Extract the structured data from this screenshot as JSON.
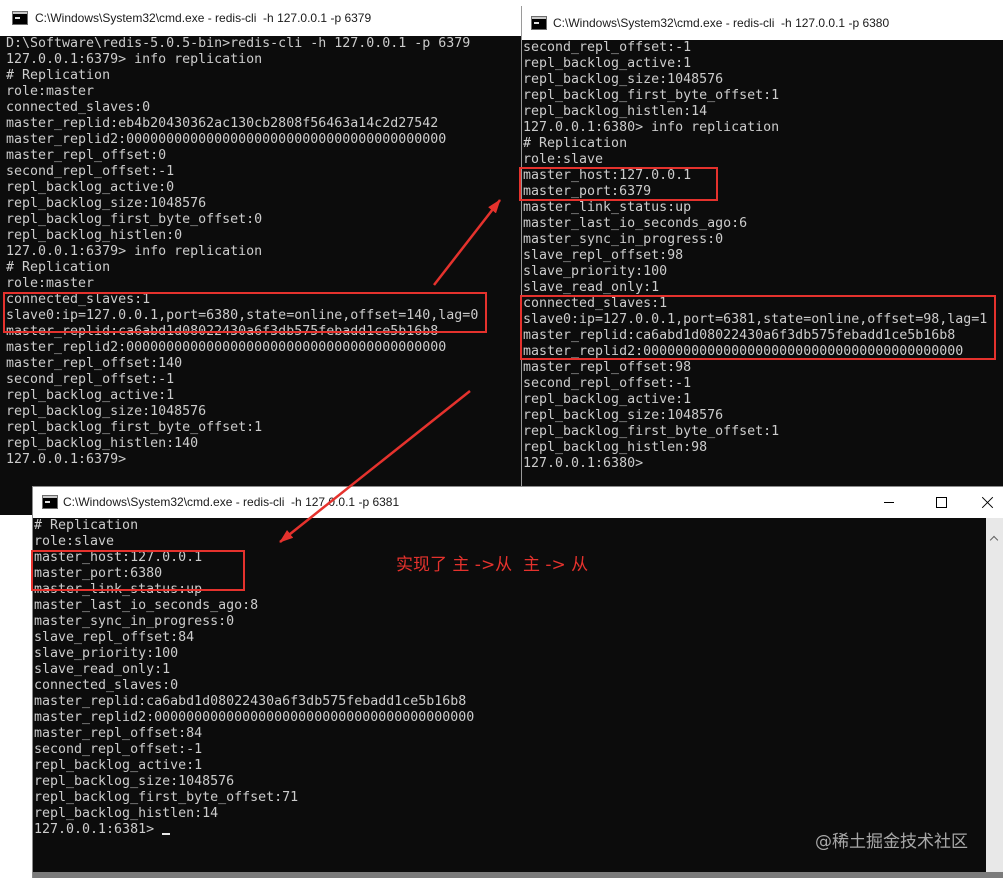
{
  "windows": [
    {
      "title": "C:\\Windows\\System32\\cmd.exe - redis-cli  -h 127.0.0.1 -p 6379",
      "lines": [
        "D:\\Software\\redis-5.0.5-bin>redis-cli -h 127.0.0.1 -p 6379",
        "127.0.0.1:6379> info replication",
        "# Replication",
        "role:master",
        "connected_slaves:0",
        "master_replid:eb4b20430362ac130cb2808f56463a14c2d27542",
        "master_replid2:0000000000000000000000000000000000000000",
        "master_repl_offset:0",
        "second_repl_offset:-1",
        "repl_backlog_active:0",
        "repl_backlog_size:1048576",
        "repl_backlog_first_byte_offset:0",
        "repl_backlog_histlen:0",
        "127.0.0.1:6379> info replication",
        "# Replication",
        "role:master",
        "connected_slaves:1",
        "slave0:ip=127.0.0.1,port=6380,state=online,offset=140,lag=0",
        "master_replid:ca6abd1d08022430a6f3db575febadd1ce5b16b8",
        "master_replid2:0000000000000000000000000000000000000000",
        "master_repl_offset:140",
        "second_repl_offset:-1",
        "repl_backlog_active:1",
        "repl_backlog_size:1048576",
        "repl_backlog_first_byte_offset:1",
        "repl_backlog_histlen:140",
        "127.0.0.1:6379>"
      ]
    },
    {
      "title": "C:\\Windows\\System32\\cmd.exe - redis-cli  -h 127.0.0.1 -p 6380",
      "lines": [
        "second_repl_offset:-1",
        "repl_backlog_active:1",
        "repl_backlog_size:1048576",
        "repl_backlog_first_byte_offset:1",
        "repl_backlog_histlen:14",
        "127.0.0.1:6380> info replication",
        "# Replication",
        "role:slave",
        "master_host:127.0.0.1",
        "master_port:6379",
        "master_link_status:up",
        "master_last_io_seconds_ago:6",
        "master_sync_in_progress:0",
        "slave_repl_offset:98",
        "slave_priority:100",
        "slave_read_only:1",
        "connected_slaves:1",
        "slave0:ip=127.0.0.1,port=6381,state=online,offset=98,lag=1",
        "master_replid:ca6abd1d08022430a6f3db575febadd1ce5b16b8",
        "master_replid2:0000000000000000000000000000000000000000",
        "master_repl_offset:98",
        "second_repl_offset:-1",
        "repl_backlog_active:1",
        "repl_backlog_size:1048576",
        "repl_backlog_first_byte_offset:1",
        "repl_backlog_histlen:98",
        "127.0.0.1:6380>"
      ]
    },
    {
      "title": "C:\\Windows\\System32\\cmd.exe - redis-cli  -h 127.0.0.1 -p 6381",
      "lines": [
        "# Replication",
        "role:slave",
        "master_host:127.0.0.1",
        "master_port:6380",
        "master_link_status:up",
        "master_last_io_seconds_ago:8",
        "master_sync_in_progress:0",
        "slave_repl_offset:84",
        "slave_priority:100",
        "slave_read_only:1",
        "connected_slaves:0",
        "master_replid:ca6abd1d08022430a6f3db575febadd1ce5b16b8",
        "master_replid2:0000000000000000000000000000000000000000",
        "master_repl_offset:84",
        "second_repl_offset:-1",
        "repl_backlog_active:1",
        "repl_backlog_size:1048576",
        "repl_backlog_first_byte_offset:71",
        "repl_backlog_histlen:14",
        "127.0.0.1:6381>"
      ]
    }
  ],
  "annotation": "实现了 主 ->从  主 -> 从",
  "watermark": "@稀土掘金技术社区",
  "icons": {
    "app": "cmd-icon",
    "minimize": "minimize-icon",
    "maximize": "maximize-icon",
    "close": "close-icon",
    "scroll_up": "scroll-up-icon"
  },
  "colors": {
    "console_bg": "#0c0c0c",
    "console_text": "#cccccc",
    "highlight": "#e5322d",
    "titlebar_bg": "#ffffff",
    "title_text": "#1a1a1a",
    "watermark": "#a8a8a8"
  }
}
